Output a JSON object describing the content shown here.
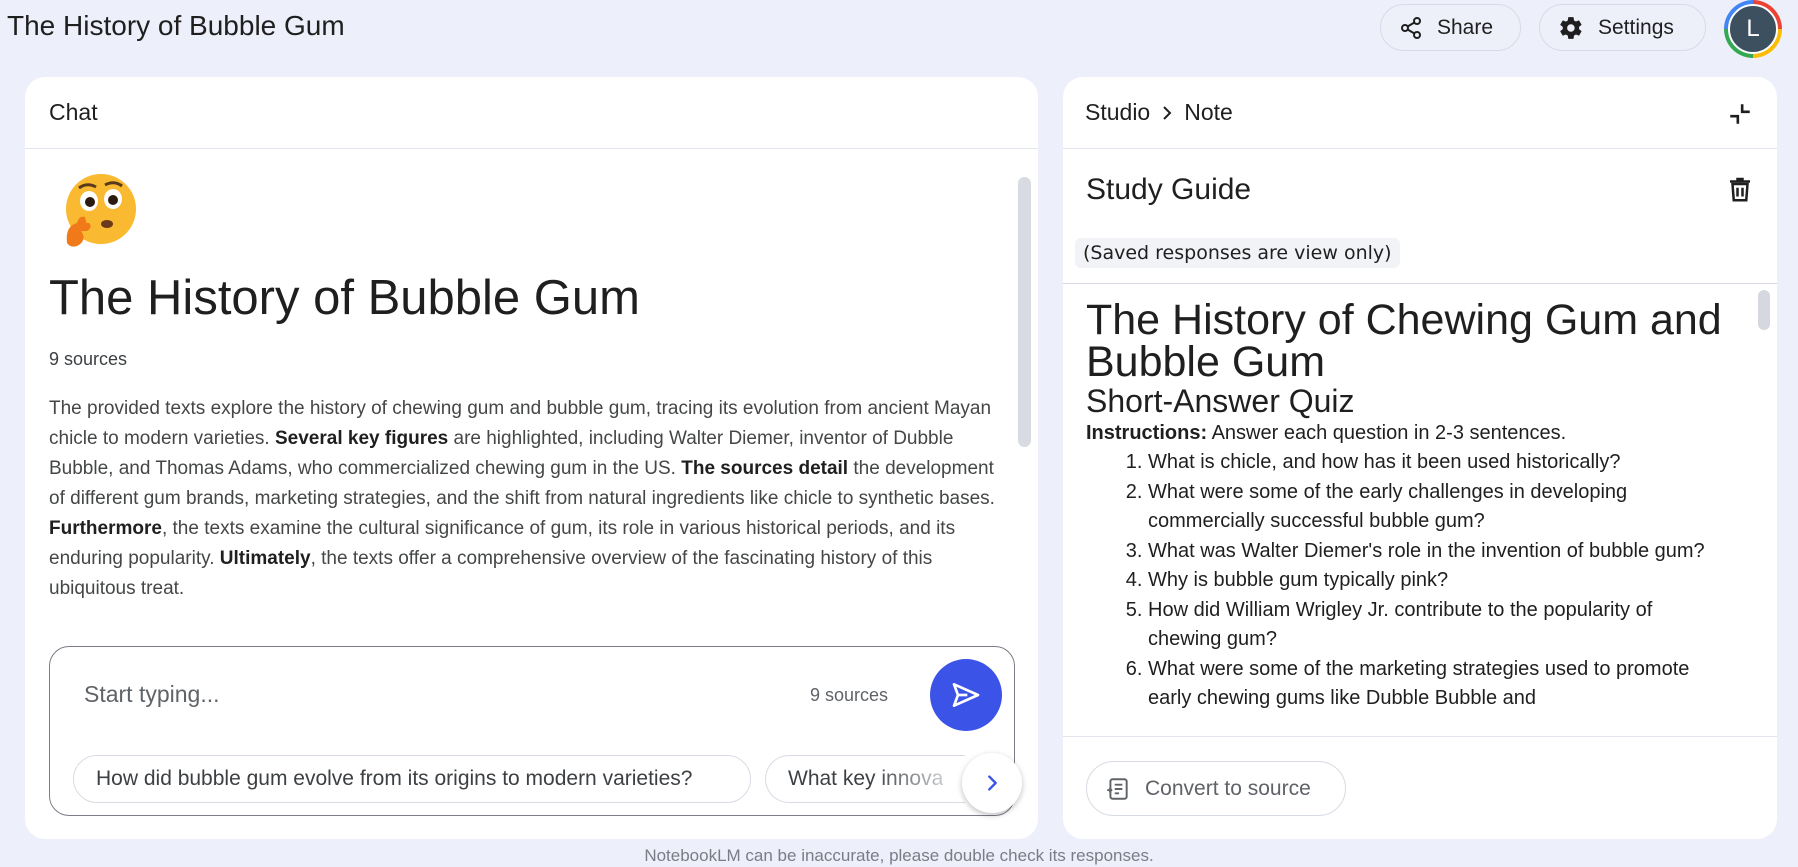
{
  "app": {
    "title": "The History of Bubble Gum",
    "share_label": "Share",
    "settings_label": "Settings",
    "avatar_letter": "L"
  },
  "chat": {
    "header": "Chat",
    "notebook_title": "The History of Bubble Gum",
    "source_count": "9 sources",
    "summary_parts": [
      "The provided texts explore the history of chewing gum and bubble gum, tracing its evolution from ancient Mayan chicle to modern varieties. ",
      "Several key figures",
      " are highlighted, including Walter Diemer, inventor of Dubble Bubble, and Thomas Adams, who commercialized chewing gum in the US. ",
      "The sources detail",
      " the development of different gum brands, marketing strategies, and the shift from natural ingredients like chicle to synthetic bases. ",
      "Furthermore",
      ", the texts examine the cultural significance of gum, its role in various historical periods, and its enduring popularity. ",
      "Ultimately",
      ", the texts offer a comprehensive overview of the fascinating history of this ubiquitous treat."
    ],
    "input_placeholder": "Start typing...",
    "input_sources": "9 sources",
    "suggestions": [
      "How did bubble gum evolve from its origins to modern varieties?",
      "What key innova"
    ]
  },
  "studio": {
    "breadcrumb_root": "Studio",
    "breadcrumb_current": "Note",
    "note_title": "Study Guide",
    "view_only_notice": "(Saved responses are view only)",
    "content_title": "The History of Chewing Gum and Bubble Gum",
    "content_subtitle": "Short-Answer Quiz",
    "instructions_label": "Instructions:",
    "instructions_text": " Answer each question in 2-3 sentences.",
    "questions": [
      "What is chicle, and how has it been used historically?",
      "What were some of the early challenges in developing commercially successful bubble gum?",
      "What was Walter Diemer's role in the invention of bubble gum?",
      "Why is bubble gum typically pink?",
      "How did William Wrigley Jr. contribute to the popularity of chewing gum?",
      "What were some of the marketing strategies used to promote early chewing gums like Dubble Bubble and"
    ],
    "convert_label": "Convert to source"
  },
  "disclaimer": "NotebookLM can be inaccurate, please double check its responses.",
  "colors": {
    "background": "#edeffa",
    "accent": "#3c53e8",
    "panel": "#ffffff"
  }
}
